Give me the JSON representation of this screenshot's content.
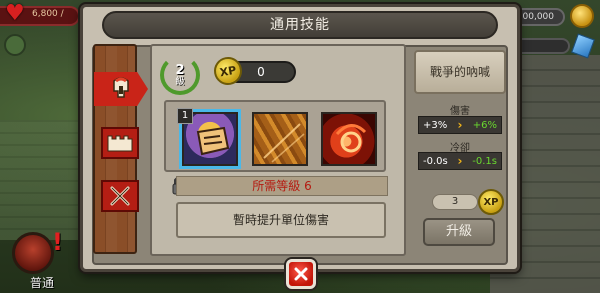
{
  "hud": {
    "hp": "6,800 /",
    "gold": "00,000,000"
  },
  "modal": {
    "title": "通用技能"
  },
  "tabs": [
    {
      "name": "warrior-tab",
      "icon": "spartan-helmet-icon",
      "active": true
    },
    {
      "name": "castle-tab",
      "icon": "castle-wall-icon",
      "active": false
    },
    {
      "name": "weapons-tab",
      "icon": "crossed-swords-icon",
      "active": false
    }
  ],
  "level": {
    "value": "2",
    "label": "級"
  },
  "xp": {
    "icon_text": "XP",
    "value": "0"
  },
  "skills": [
    {
      "name": "punch-skill",
      "badge": "1",
      "selected": true
    },
    {
      "name": "slash-skill",
      "selected": false
    },
    {
      "name": "fire-skill",
      "selected": false
    }
  ],
  "requirement": "所需等級 6",
  "description": "暫時提升單位傷害",
  "right": {
    "skill_name": "戰爭的吶喊",
    "damage_label": "傷害",
    "damage_old": "+3%",
    "damage_new": "+6%",
    "cooldown_label": "冷卻",
    "cooldown_old": "-0.0s",
    "cooldown_new": "-0.1s",
    "cost": "3",
    "cost_icon_text": "XP",
    "upgrade_label": "升級"
  },
  "unit": {
    "label": "普通"
  },
  "colors": {
    "tab_red": "#b41e14",
    "requirement_red": "#b51a10",
    "stat_green": "#6ad82f",
    "arrow_yellow": "#f1b51a",
    "selected_outline": "#4ab8e8"
  }
}
